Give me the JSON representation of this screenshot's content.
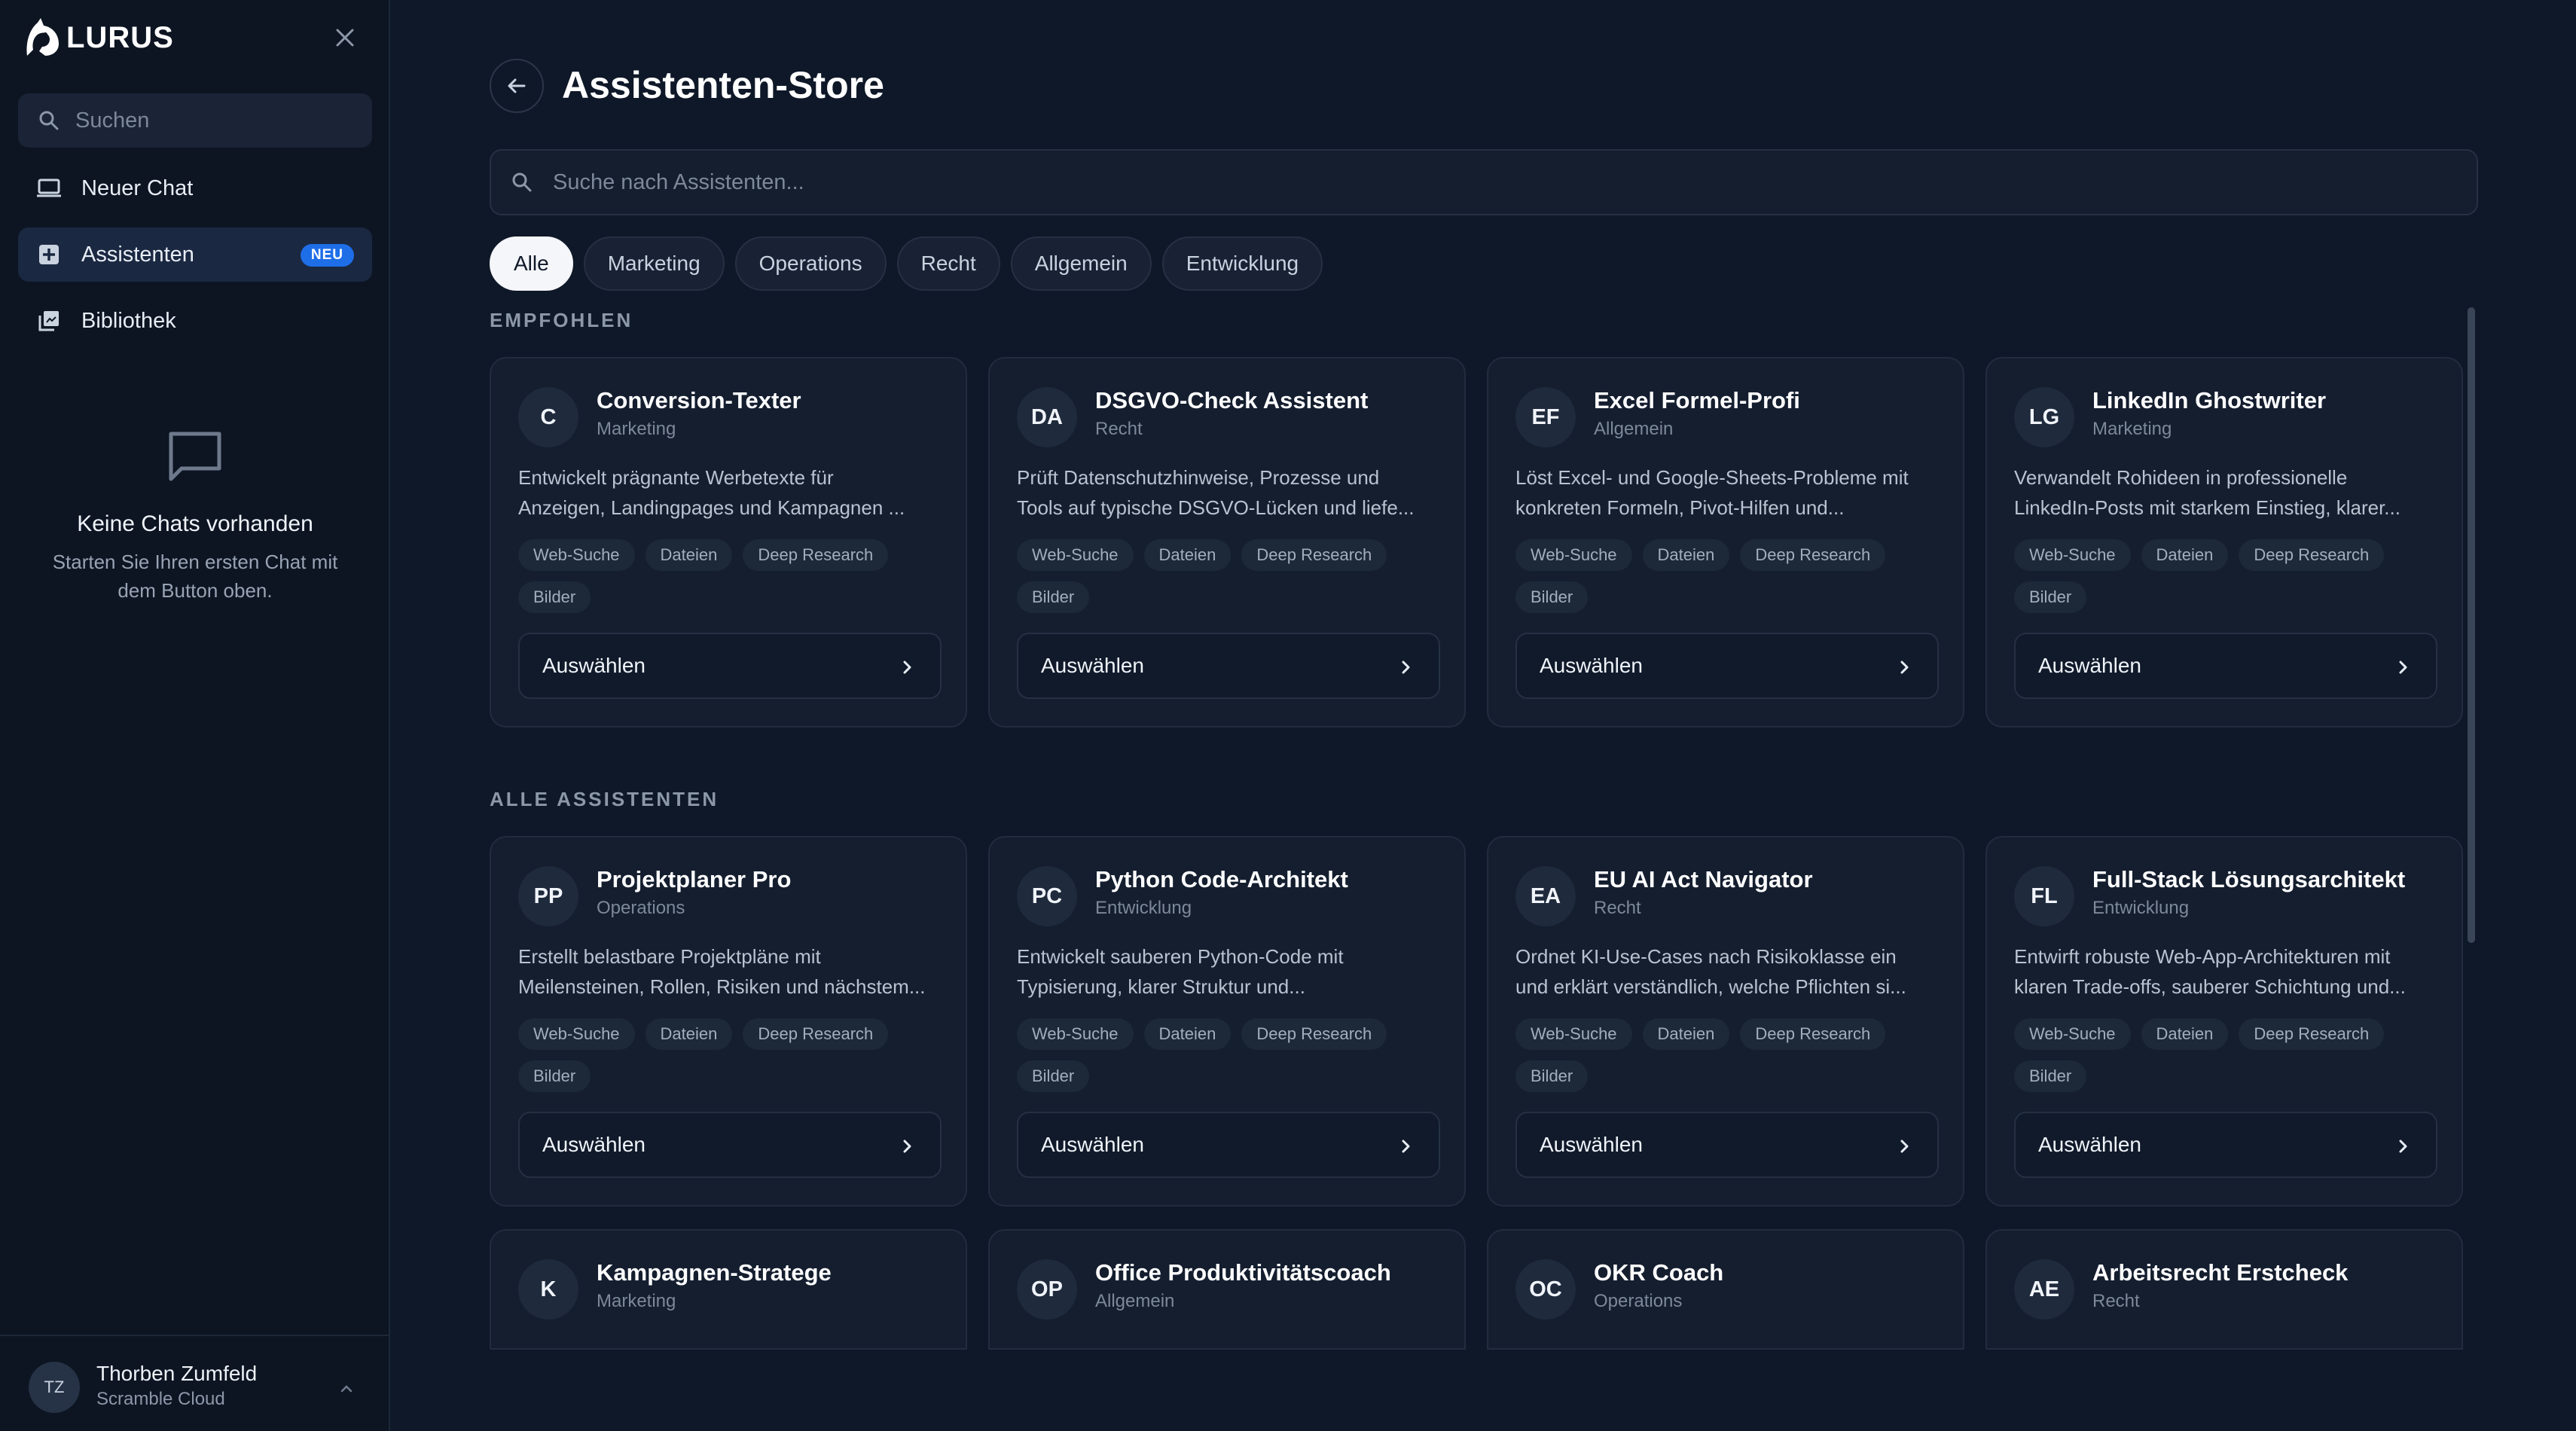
{
  "app": {
    "name": "LURUS"
  },
  "sidebar": {
    "search_placeholder": "Suchen",
    "nav": [
      {
        "label": "Neuer Chat",
        "icon": "laptop-icon"
      },
      {
        "label": "Assistenten",
        "icon": "assistant-icon",
        "badge": "NEU",
        "active": true
      },
      {
        "label": "Bibliothek",
        "icon": "library-icon"
      }
    ],
    "empty": {
      "title": "Keine Chats vorhanden",
      "line1": "Starten Sie Ihren ersten Chat mit",
      "line2": "dem Button oben."
    },
    "user": {
      "initials": "TZ",
      "name": "Thorben Zumfeld",
      "org": "Scramble Cloud"
    }
  },
  "main": {
    "title": "Assistenten-Store",
    "search_placeholder": "Suche nach Assistenten...",
    "filters": [
      "Alle",
      "Marketing",
      "Operations",
      "Recht",
      "Allgemein",
      "Entwicklung"
    ],
    "active_filter": "Alle",
    "featured_label": "EMPFOHLEN",
    "all_label": "ALLE ASSISTENTEN",
    "select_label": "Auswählen",
    "tags": [
      "Web-Suche",
      "Dateien",
      "Deep Research",
      "Bilder"
    ],
    "featured": [
      {
        "initials": "C",
        "title": "Conversion-Texter",
        "category": "Marketing",
        "desc1": "Entwickelt prägnante Werbetexte für",
        "desc2": "Anzeigen, Landingpages und Kampagnen ..."
      },
      {
        "initials": "DA",
        "title": "DSGVO-Check Assistent",
        "category": "Recht",
        "desc1": "Prüft Datenschutzhinweise, Prozesse und",
        "desc2": "Tools auf typische DSGVO-Lücken und liefe..."
      },
      {
        "initials": "EF",
        "title": "Excel Formel-Profi",
        "category": "Allgemein",
        "desc1": "Löst Excel- und Google-Sheets-Probleme mit",
        "desc2": "konkreten Formeln, Pivot-Hilfen und..."
      },
      {
        "initials": "LG",
        "title": "LinkedIn Ghostwriter",
        "category": "Marketing",
        "desc1": "Verwandelt Rohideen in professionelle",
        "desc2": "LinkedIn-Posts mit starkem Einstieg, klarer..."
      }
    ],
    "all": [
      {
        "initials": "PP",
        "title": "Projektplaner Pro",
        "category": "Operations",
        "desc1": "Erstellt belastbare Projektpläne mit",
        "desc2": "Meilensteinen, Rollen, Risiken und nächstem..."
      },
      {
        "initials": "PC",
        "title": "Python Code-Architekt",
        "category": "Entwicklung",
        "desc1": "Entwickelt sauberen Python-Code mit",
        "desc2": "Typisierung, klarer Struktur und..."
      },
      {
        "initials": "EA",
        "title": "EU AI Act Navigator",
        "category": "Recht",
        "desc1": "Ordnet KI-Use-Cases nach Risikoklasse ein",
        "desc2": "und erklärt verständlich, welche Pflichten si..."
      },
      {
        "initials": "FL",
        "title": "Full-Stack Lösungsarchitekt",
        "category": "Entwicklung",
        "desc1": "Entwirft robuste Web-App-Architekturen mit",
        "desc2": "klaren Trade-offs, sauberer Schichtung und..."
      }
    ],
    "more": [
      {
        "initials": "K",
        "title": "Kampagnen-Stratege",
        "category": "Marketing"
      },
      {
        "initials": "OP",
        "title": "Office Produktivitätscoach",
        "category": "Allgemein"
      },
      {
        "initials": "OC",
        "title": "OKR Coach",
        "category": "Operations"
      },
      {
        "initials": "AE",
        "title": "Arbeitsrecht Erstcheck",
        "category": "Recht"
      }
    ]
  }
}
